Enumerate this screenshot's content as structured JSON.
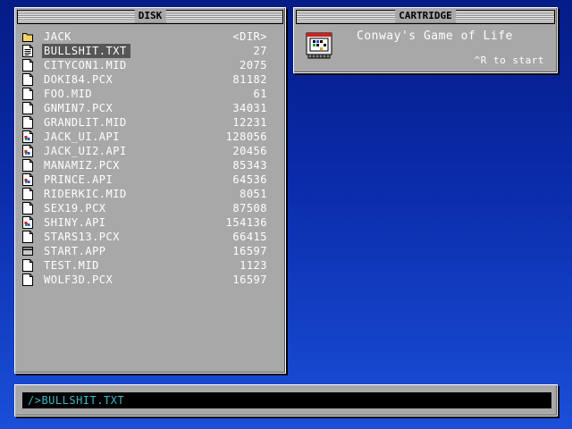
{
  "disk": {
    "title": "DISK",
    "files": [
      {
        "name": "JACK",
        "size": "<DIR>",
        "icon": "folder-icon",
        "selected": false
      },
      {
        "name": "BULLSHIT.TXT",
        "size": "27",
        "icon": "text-file-icon",
        "selected": true
      },
      {
        "name": "CITYCON1.MID",
        "size": "2075",
        "icon": "file-icon",
        "selected": false
      },
      {
        "name": "DOKI84.PCX",
        "size": "81182",
        "icon": "file-icon",
        "selected": false
      },
      {
        "name": "FOO.MID",
        "size": "61",
        "icon": "file-icon",
        "selected": false
      },
      {
        "name": "GNMIN7.PCX",
        "size": "34031",
        "icon": "file-icon",
        "selected": false
      },
      {
        "name": "GRANDLIT.MID",
        "size": "12231",
        "icon": "file-icon",
        "selected": false
      },
      {
        "name": "JACK_UI.API",
        "size": "128056",
        "icon": "app-file-icon",
        "selected": false
      },
      {
        "name": "JACK_UI2.API",
        "size": "20456",
        "icon": "app-file-icon",
        "selected": false
      },
      {
        "name": "MANAMIZ.PCX",
        "size": "85343",
        "icon": "file-icon",
        "selected": false
      },
      {
        "name": "PRINCE.API",
        "size": "64536",
        "icon": "app-file-icon",
        "selected": false
      },
      {
        "name": "RIDERKIC.MID",
        "size": "8051",
        "icon": "file-icon",
        "selected": false
      },
      {
        "name": "SEX19.PCX",
        "size": "87508",
        "icon": "file-icon",
        "selected": false
      },
      {
        "name": "SHINY.API",
        "size": "154136",
        "icon": "app-file-icon",
        "selected": false
      },
      {
        "name": "STARS13.PCX",
        "size": "66415",
        "icon": "file-icon",
        "selected": false
      },
      {
        "name": "START.APP",
        "size": "16597",
        "icon": "window-app-icon",
        "selected": false
      },
      {
        "name": "TEST.MID",
        "size": "1123",
        "icon": "file-icon",
        "selected": false
      },
      {
        "name": "WOLF3D.PCX",
        "size": "16597",
        "icon": "file-icon",
        "selected": false
      }
    ]
  },
  "cartridge": {
    "title": "CARTRIDGE",
    "icon": "cartridge-icon",
    "name": "Conway's Game of Life",
    "hint": "^R to start"
  },
  "command": {
    "text": "/>BULLSHIT.TXT"
  },
  "colors": {
    "background_top": "#041c86",
    "background_bottom": "#1a4fd8",
    "panel": "#a8a8a8",
    "selection": "#565656",
    "command_text": "#3fb7c9"
  }
}
